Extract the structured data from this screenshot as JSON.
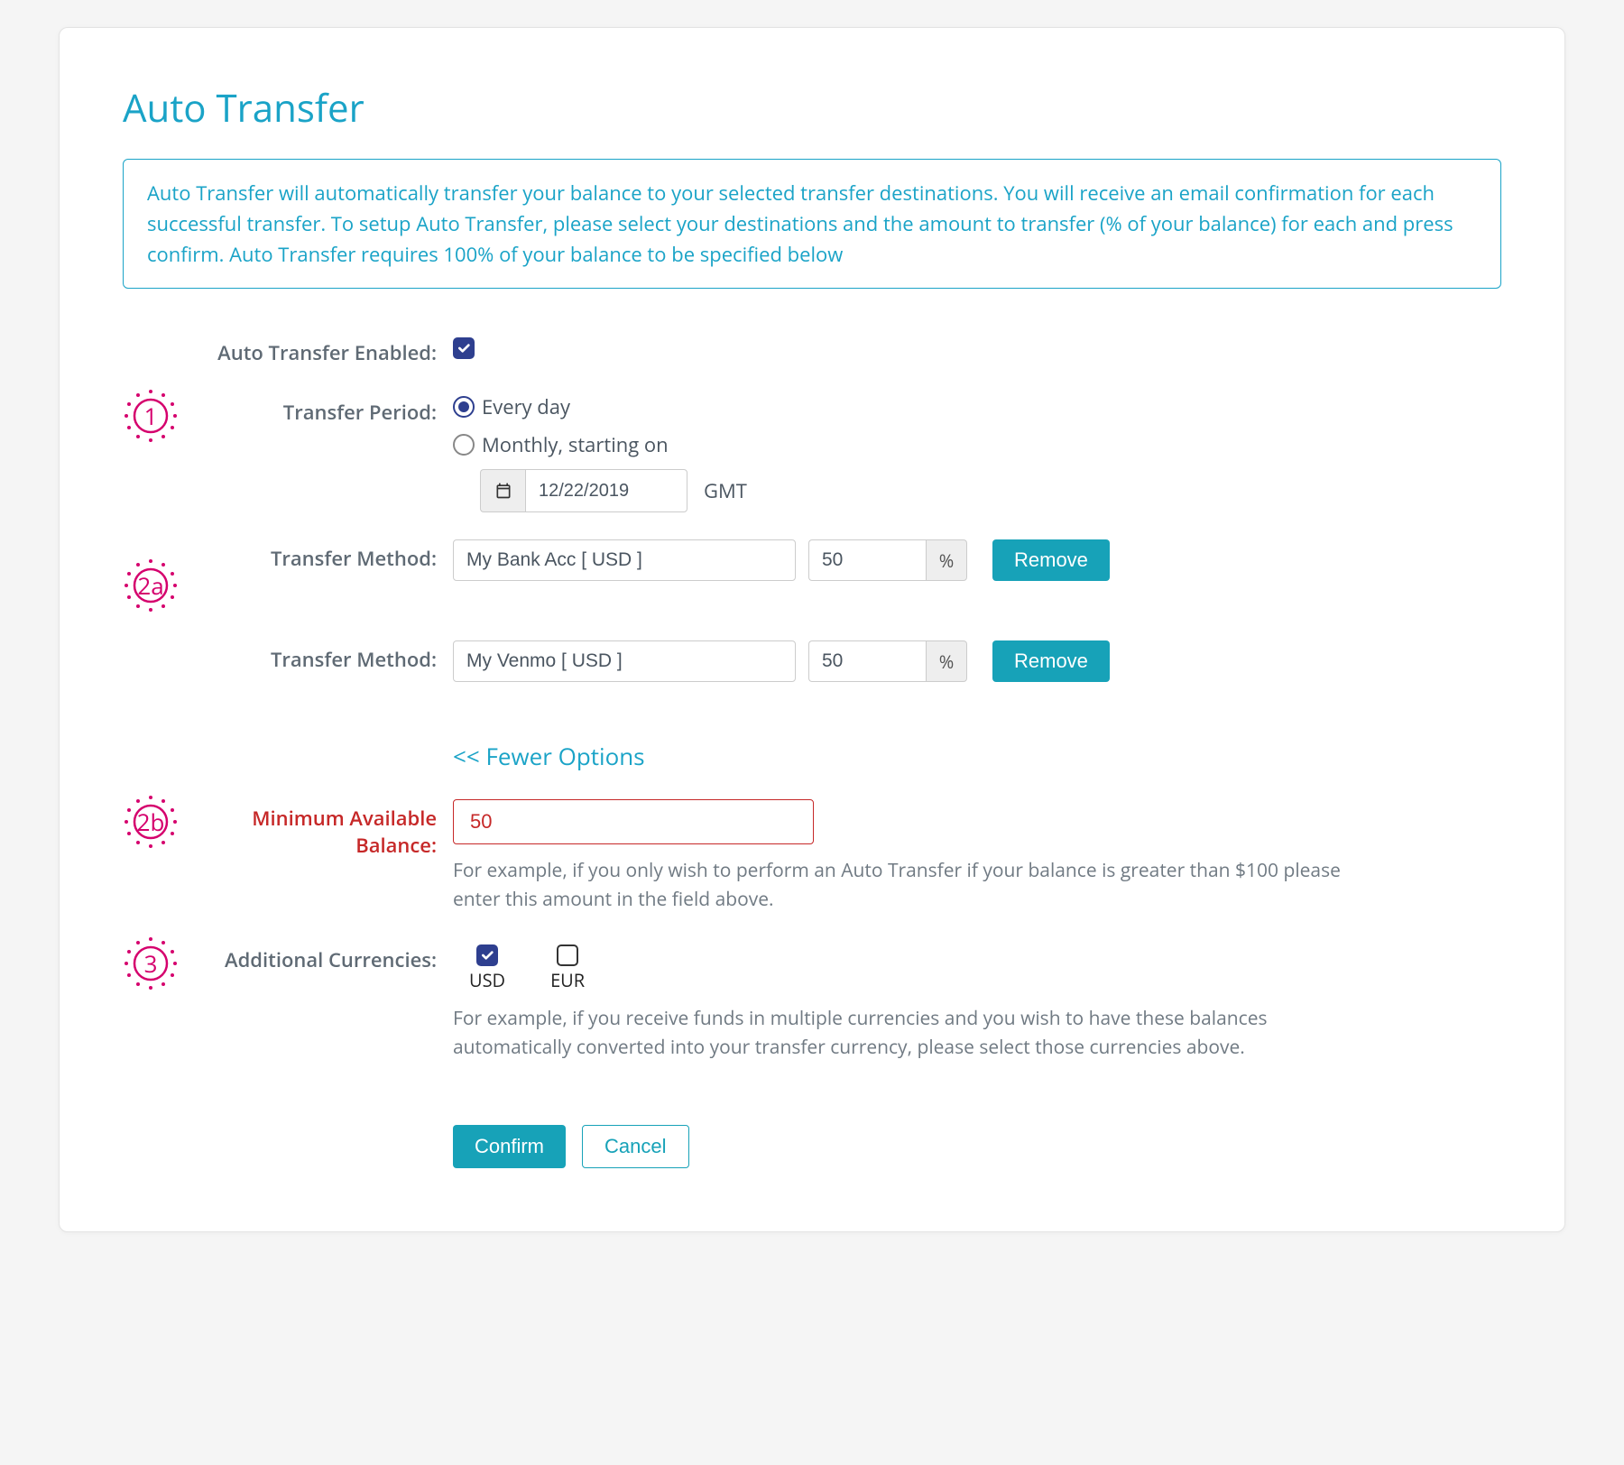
{
  "title": "Auto Transfer",
  "info_text": "Auto Transfer will automatically transfer your balance to your selected transfer destinations. You will receive an email confirmation for each successful transfer. To setup Auto Transfer, please select your destinations and the amount to transfer (% of your balance) for each and press confirm. Auto Transfer requires 100% of your balance to be specified below",
  "labels": {
    "enabled": "Auto Transfer Enabled:",
    "period": "Transfer Period:",
    "method": "Transfer Method:",
    "min_balance": "Minimum Available Balance:",
    "additional_currencies": "Additional Currencies:"
  },
  "bullets": {
    "b1": "1",
    "b2a": "2a",
    "b2b": "2b",
    "b3": "3"
  },
  "period": {
    "every_day": "Every day",
    "monthly": "Monthly, starting on",
    "date": "12/22/2019",
    "tz": "GMT"
  },
  "methods": [
    {
      "name": "My Bank Acc [ USD ]",
      "pct": "50"
    },
    {
      "name": "My Venmo [ USD ]",
      "pct": "50"
    }
  ],
  "pct_symbol": "%",
  "remove_label": "Remove",
  "fewer_options": "<< Fewer Options",
  "min_balance_value": "50",
  "min_balance_help": "For example, if you only wish to perform an Auto Transfer if your balance is greater than $100 please enter this amount in the field above.",
  "currencies": [
    {
      "code": "USD",
      "checked": true
    },
    {
      "code": "EUR",
      "checked": false
    }
  ],
  "currencies_help": "For example, if you receive funds in multiple currencies and you wish to have these balances automatically converted into your transfer currency, please select those currencies above.",
  "confirm_label": "Confirm",
  "cancel_label": "Cancel"
}
